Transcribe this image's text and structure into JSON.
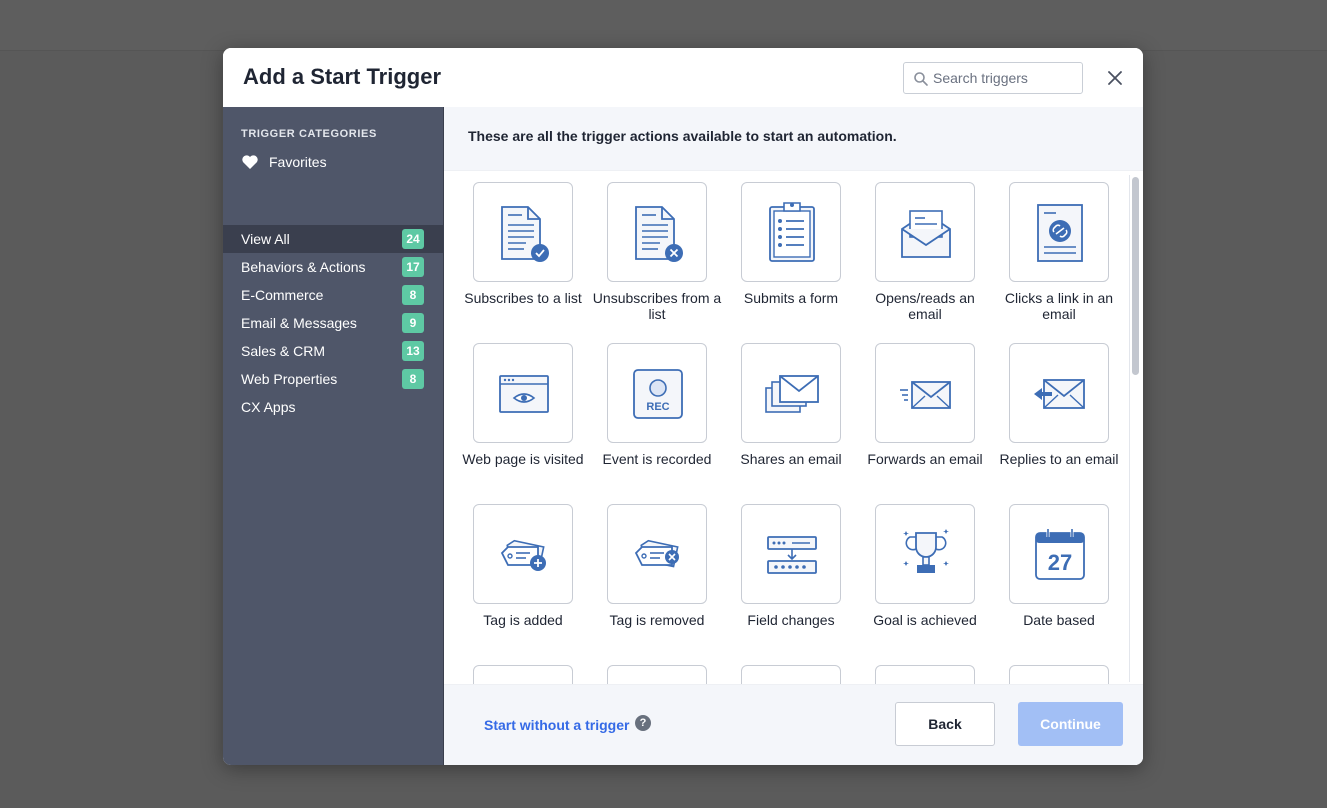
{
  "modal": {
    "title": "Add a Start Trigger",
    "search_placeholder": "Search triggers"
  },
  "sidebar": {
    "heading": "TRIGGER CATEGORIES",
    "favorites_label": "Favorites",
    "items": [
      {
        "label": "View All",
        "count": "24",
        "active": true
      },
      {
        "label": "Behaviors & Actions",
        "count": "17"
      },
      {
        "label": "E-Commerce",
        "count": "8"
      },
      {
        "label": "Email & Messages",
        "count": "9"
      },
      {
        "label": "Sales & CRM",
        "count": "13"
      },
      {
        "label": "Web Properties",
        "count": "8"
      },
      {
        "label": "CX Apps",
        "count": null
      }
    ]
  },
  "content": {
    "intro": "These are all the trigger actions available to start an automation.",
    "triggers": [
      {
        "label": "Subscribes to a list",
        "icon": "list-subscribe-icon"
      },
      {
        "label": "Unsubscribes from a list",
        "icon": "list-unsubscribe-icon"
      },
      {
        "label": "Submits a form",
        "icon": "clipboard-form-icon"
      },
      {
        "label": "Opens/reads an email",
        "icon": "open-envelope-icon"
      },
      {
        "label": "Clicks a link in an email",
        "icon": "link-document-icon"
      },
      {
        "label": "Web page is visited",
        "icon": "browser-eye-icon"
      },
      {
        "label": "Event is recorded",
        "icon": "rec-event-icon"
      },
      {
        "label": "Shares an email",
        "icon": "share-envelopes-icon"
      },
      {
        "label": "Forwards an email",
        "icon": "forward-envelope-icon"
      },
      {
        "label": "Replies to an email",
        "icon": "reply-envelope-icon"
      },
      {
        "label": "Tag is added",
        "icon": "tag-add-icon"
      },
      {
        "label": "Tag is removed",
        "icon": "tag-remove-icon"
      },
      {
        "label": "Field changes",
        "icon": "field-change-icon"
      },
      {
        "label": "Goal is achieved",
        "icon": "trophy-icon"
      },
      {
        "label": "Date based",
        "icon": "calendar-icon",
        "day": "27"
      }
    ]
  },
  "footer": {
    "start_without_label": "Start without a trigger",
    "help": "?",
    "back_label": "Back",
    "continue_label": "Continue"
  },
  "colors": {
    "accent": "#356ae6",
    "icon_blue": "#3d6db5",
    "badge": "#5ec9a4",
    "sidebar": "#4f5669",
    "continue_disabled": "#a2bff5"
  }
}
